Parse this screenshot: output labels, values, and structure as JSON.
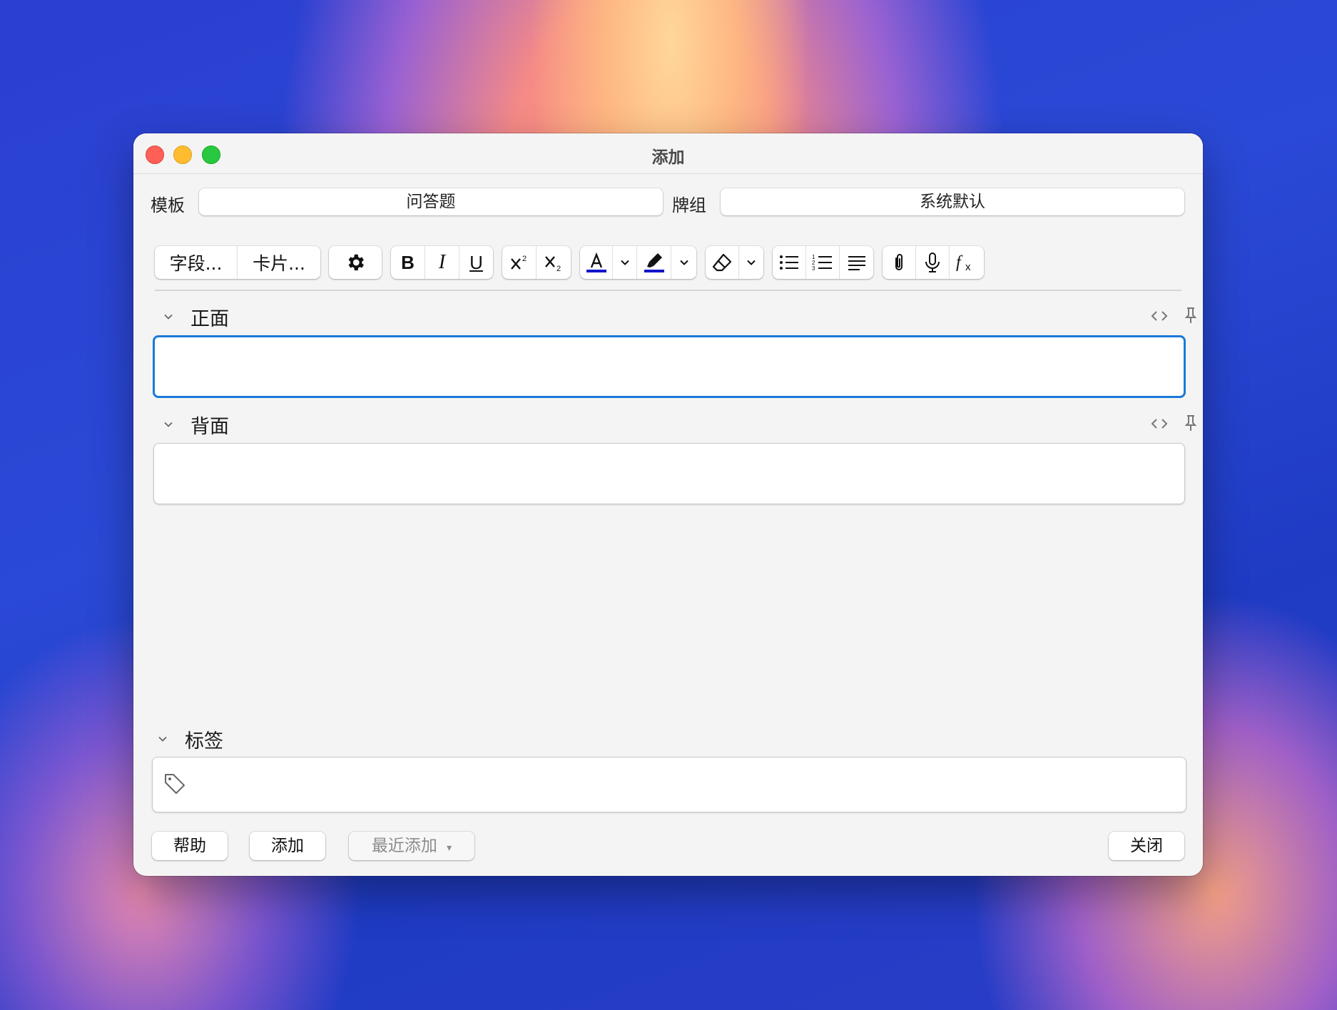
{
  "window": {
    "title": "添加"
  },
  "controls": {
    "template_label": "模板",
    "template_value": "问答题",
    "deck_label": "牌组",
    "deck_value": "系统默认"
  },
  "toolbar": {
    "fields_button": "字段...",
    "cards_button": "卡片...",
    "bold": "B",
    "italic": "I",
    "underline": "U",
    "text_color": "#1414cc",
    "highlight_color": "#1414cc"
  },
  "fields": [
    {
      "label": "正面"
    },
    {
      "label": "背面"
    }
  ],
  "tags": {
    "label": "标签"
  },
  "buttons": {
    "help": "帮助",
    "add": "添加",
    "history": "最近添加",
    "history_arrow": "▾",
    "close": "关闭"
  }
}
